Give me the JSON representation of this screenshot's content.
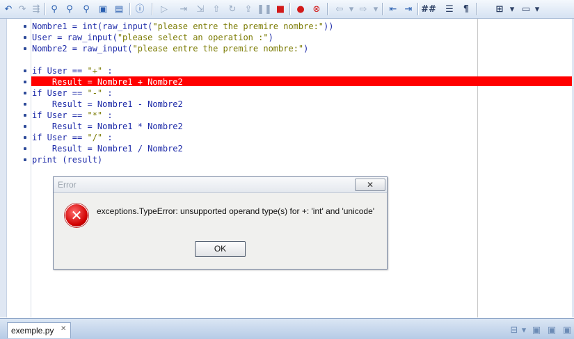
{
  "toolbar": {
    "icons": [
      "undo-icon",
      "redo-icon",
      "find-icon",
      "find-next-icon",
      "replace-icon",
      "bookmark-icon",
      "find-in-files-icon",
      "info-icon",
      "run-icon",
      "step-into-icon",
      "step-over-icon",
      "step-out-icon",
      "run-to-icon",
      "pause-icon",
      "stop-icon",
      "breakpoint-icon",
      "clear-breakpoints-icon",
      "nav-back-icon",
      "nav-forward-icon",
      "indent-icon",
      "outdent-icon",
      "comment-icon",
      "list-icon",
      "show-whitespace-icon",
      "view-menu-icon",
      "window-menu-icon"
    ]
  },
  "editor": {
    "highlighted_line": 6,
    "lines": [
      {
        "segments": [
          {
            "t": "Nombre1 = int(raw_input(",
            "c": "code"
          },
          {
            "t": "\"please entre the premire nombre:\"",
            "c": "str"
          },
          {
            "t": "))",
            "c": "code"
          }
        ]
      },
      {
        "segments": [
          {
            "t": "User = raw_input(",
            "c": "code"
          },
          {
            "t": "\"please select an operation :\"",
            "c": "str"
          },
          {
            "t": ")",
            "c": "code"
          }
        ]
      },
      {
        "segments": [
          {
            "t": "Nombre2 = raw_input(",
            "c": "code"
          },
          {
            "t": "\"please entre the premire nombre:\"",
            "c": "str"
          },
          {
            "t": ")",
            "c": "code"
          }
        ]
      },
      {
        "segments": []
      },
      {
        "segments": [
          {
            "t": "if User == ",
            "c": "code"
          },
          {
            "t": "\"+\"",
            "c": "str"
          },
          {
            "t": " :",
            "c": "code"
          }
        ]
      },
      {
        "segments": [
          {
            "t": "    Result = Nombre1 + Nombre2",
            "c": "code"
          }
        ]
      },
      {
        "segments": [
          {
            "t": "if User == ",
            "c": "code"
          },
          {
            "t": "\"-\"",
            "c": "str"
          },
          {
            "t": " :",
            "c": "code"
          }
        ]
      },
      {
        "segments": [
          {
            "t": "    Result = Nombre1 - Nombre2",
            "c": "code"
          }
        ]
      },
      {
        "segments": [
          {
            "t": "if User == ",
            "c": "code"
          },
          {
            "t": "\"*\"",
            "c": "str"
          },
          {
            "t": " :",
            "c": "code"
          }
        ]
      },
      {
        "segments": [
          {
            "t": "    Result = Nombre1 * Nombre2",
            "c": "code"
          }
        ]
      },
      {
        "segments": [
          {
            "t": "if User == ",
            "c": "code"
          },
          {
            "t": "\"/\"",
            "c": "str"
          },
          {
            "t": " :",
            "c": "code"
          }
        ]
      },
      {
        "segments": [
          {
            "t": "    Result = Nombre1 / Nombre2",
            "c": "code"
          }
        ]
      },
      {
        "segments": [
          {
            "t": "print (result)",
            "c": "code"
          }
        ]
      }
    ]
  },
  "dialog": {
    "title": "Error",
    "close_label": "✕",
    "message": "exceptions.TypeError: unsupported operand type(s) for +: 'int' and 'unicode'",
    "ok_label": "OK"
  },
  "tabs": [
    {
      "label": "exemple.py",
      "close_label": "✕"
    }
  ],
  "colors": {
    "highlight": "#ff0000",
    "code_text": "#1d2aa8",
    "string": "#7a7a00"
  }
}
